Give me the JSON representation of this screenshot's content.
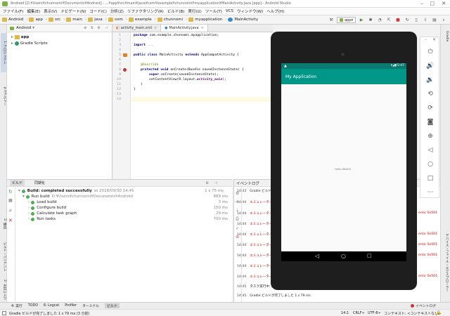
{
  "window": {
    "title": "Android [D:¥Users¥chunnomi¥Documents¥Android] - ...¥app¥src¥main¥java¥com¥example¥chunnomi¥myapplication¥MainActivity.java [app] - Android Studio"
  },
  "menu": [
    "ファイル(F)",
    "編集(E)",
    "表示(V)",
    "ナビゲート(N)",
    "コード(C)",
    "分析(Z)",
    "リファクタリング(R)",
    "ビルド(B)",
    "実行(U)",
    "ツール(T)",
    "VCS",
    "ウィンドウ(W)",
    "ヘルプ(H)"
  ],
  "breadcrumb": [
    "Android",
    "app",
    "src",
    "main",
    "java",
    "com",
    "example",
    "chunnomi",
    "myapplication",
    "MainActivity"
  ],
  "toolbar": {
    "run_config": "app"
  },
  "left_tools": [
    "1: プロジェクト",
    "キャプチャー",
    "2: 構造",
    "ビルド・バリアント",
    "2: お気に入り"
  ],
  "project": {
    "view": "Android",
    "items": [
      {
        "label": "app"
      },
      {
        "label": "Gradle Scripts"
      }
    ]
  },
  "editor": {
    "tabs": [
      "activity_main.xml",
      "MainActivity.java"
    ],
    "lines": [
      "1",
      "2",
      "3",
      "4",
      "5",
      "6",
      "7",
      "8",
      "9",
      "10",
      "11",
      "12",
      "13",
      "14"
    ],
    "code": {
      "l1_kw": "package",
      "l1_rest": " com.example.chunnomi.myapplication;",
      "l3_kw": "import",
      "l3_rest": " ...",
      "l5_kw": "public class",
      "l5_name": " MainActivity ",
      "l5_kw2": "extends",
      "l5_rest": " AppCompatActivity {",
      "l7": "@Override",
      "l8_kw": "protected void",
      "l8_rest": " onCreate(Bundle savedInstanceState) {",
      "l9_kw": "super",
      "l9_rest": ".onCreate(savedInstanceState);",
      "l10_a": "setContentView(R.layout.",
      "l10_f": "activity_main",
      "l10_b": ");",
      "l11": "}",
      "l12": "}"
    }
  },
  "build": {
    "tabs": [
      "ビルド",
      "同期化"
    ],
    "root": "Build: completed successfully",
    "root_time": "at 2018/09/30 14:45",
    "root_dur": "1 s 75 ms",
    "run_build": "Run build",
    "run_build_path": "D:¥Users¥chunnomi¥Documents¥Android",
    "run_build_dur": "889 ms",
    "children": [
      {
        "label": "Load build",
        "dur": "3 ms"
      },
      {
        "label": "Configure build",
        "dur": "150 ms"
      },
      {
        "label": "Calculate task graph",
        "dur": "29 ms"
      },
      {
        "label": "Run tasks",
        "dur": "700 ms"
      }
    ]
  },
  "eventlog": {
    "title": "イベントログ",
    "first": {
      "time": "14:43",
      "msg": "Gradle ビルドが"
    },
    "errors": [
      {
        "time": "14:44",
        "msg": "エミュレーター: er"
      },
      {
        "time": "14:44",
        "msg": "エミュレーター: er"
      },
      {
        "time": "14:44",
        "msg": "エミュレーター: er"
      },
      {
        "time": "14:44",
        "msg": "エミュレーター: er"
      },
      {
        "time": "14:44",
        "msg": "エミュレーター: er"
      },
      {
        "time": "14:44",
        "msg": "エミュレーター: er"
      },
      {
        "time": "14:44",
        "msg": "エミュレーター: er"
      },
      {
        "time": "14:44",
        "msg": "エミュレーター: er"
      }
    ],
    "error_suffix": "error 0x501",
    "task_row": {
      "time": "14:45",
      "msg": "タスク実行中: ["
    },
    "last": {
      "time": "14:45",
      "msg": "Gradle ビルドが完了しました 1 s 79 ms"
    }
  },
  "right_tools": [
    "Gradle",
    "デバイス・ファイル・エクスプローラー"
  ],
  "bottom_tools": [
    "4: 実行",
    "TODO",
    "6: Logcat",
    "Profiler",
    "ターミナル",
    "ビルド"
  ],
  "bottom_right": "イベントログ",
  "status": {
    "message": "Gradle ビルドが完了しました 1 s 79 ms (3 分前)",
    "position": "14:1",
    "line_sep": "CRLF÷",
    "encoding": "UTF-8÷",
    "context": "コンテキスト: <コンテキストなし>"
  },
  "emulator": {
    "app_title": "My Application",
    "clock": "5:47",
    "hello": "Hello World!"
  }
}
